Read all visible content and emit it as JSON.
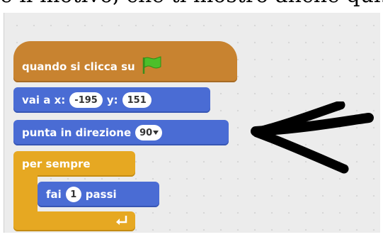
{
  "page": {
    "cut_text": "è il motivo, che ti mostro anche qui."
  },
  "script": {
    "hat_label": "quando si clicca su",
    "goto_label_x": "vai a x:",
    "goto_x_value": "-195",
    "goto_label_y": "y:",
    "goto_y_value": "151",
    "point_label": "punta in direzione",
    "point_value": "90",
    "forever_label": "per sempre",
    "move_label_1": "fai",
    "move_value": "1",
    "move_label_2": "passi"
  },
  "icons": {
    "flag": "green-flag-icon",
    "dropdown": "triangle-down",
    "loop": "loop-arrow-icon",
    "annotation": "hand-drawn-arrow"
  },
  "colors": {
    "events": "#c88330",
    "motion": "#4a6cd4",
    "control": "#e6a822",
    "flag": "#4cbf2a",
    "canvas": "#ececec"
  }
}
